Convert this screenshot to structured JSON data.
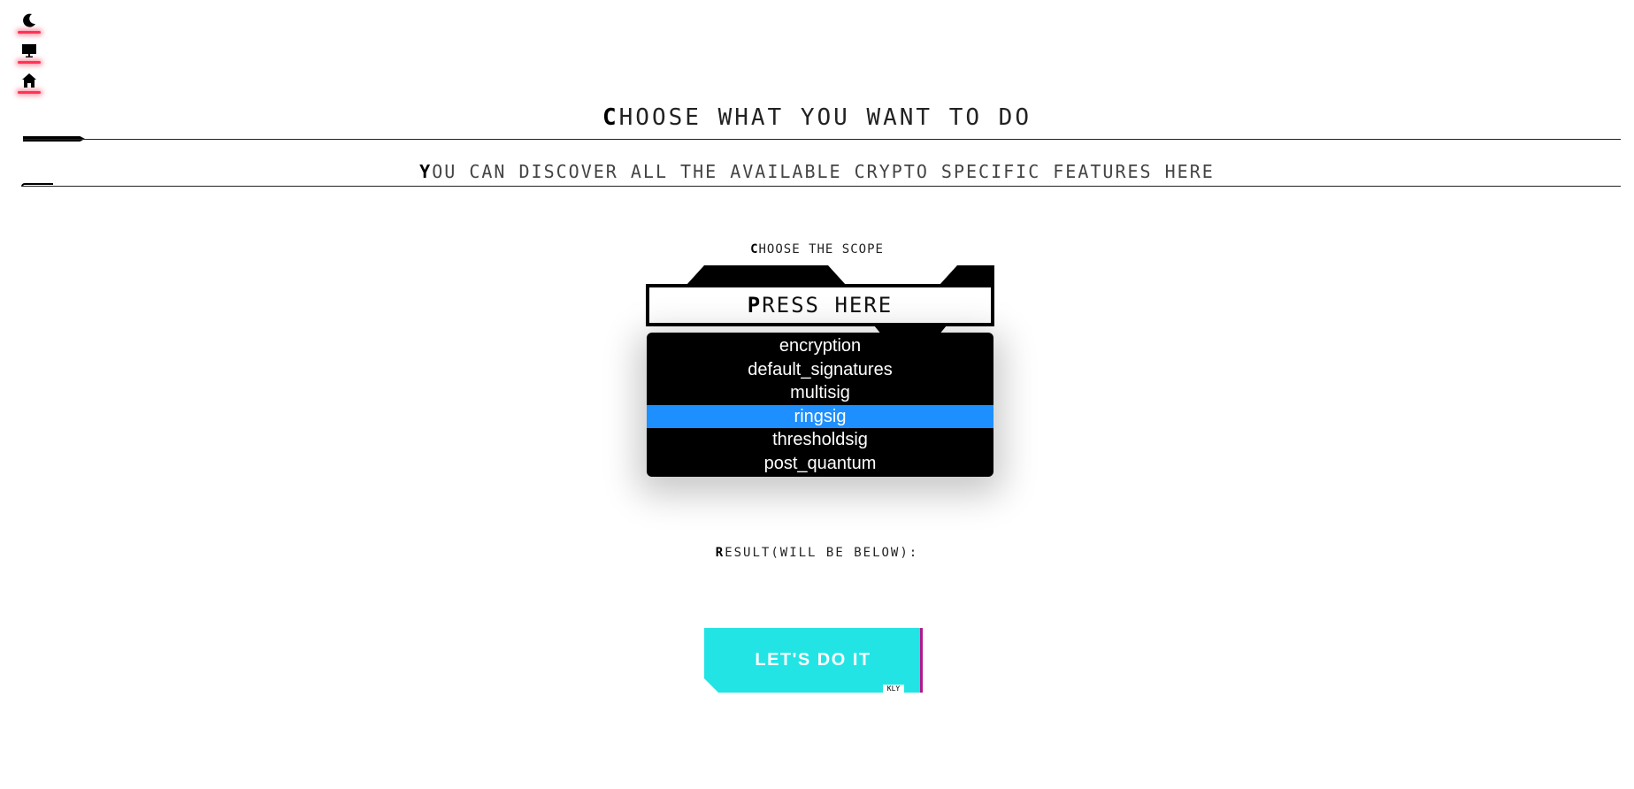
{
  "top_icons": [
    {
      "name": "moon-icon"
    },
    {
      "name": "monitor-icon"
    },
    {
      "name": "home-icon"
    }
  ],
  "header": {
    "title_first": "C",
    "title_rest": "HOOSE WHAT YOU WANT TO DO",
    "subtitle_first": "Y",
    "subtitle_rest": "OU CAN DISCOVER ALL THE AVAILABLE CRYPTO SPECIFIC FEATURES HERE"
  },
  "scope": {
    "label_first": "C",
    "label_rest": "HOOSE THE SCOPE",
    "press_first": "P",
    "press_rest": "RESS HERE",
    "options": [
      "encryption",
      "default_signatures",
      "multisig",
      "ringsig",
      "thresholdsig",
      "post_quantum"
    ],
    "selected": "ringsig"
  },
  "result": {
    "label_first": "R",
    "label_rest": "ESULT(WILL BE BELOW):"
  },
  "action": {
    "button_label": "LET'S DO IT",
    "tag": "KLY"
  },
  "colors": {
    "accent_glow": "#ff3355",
    "selected_option": "#1e8fff",
    "button_bg": "#22e4e4",
    "button_edge": "#b01a8c"
  }
}
